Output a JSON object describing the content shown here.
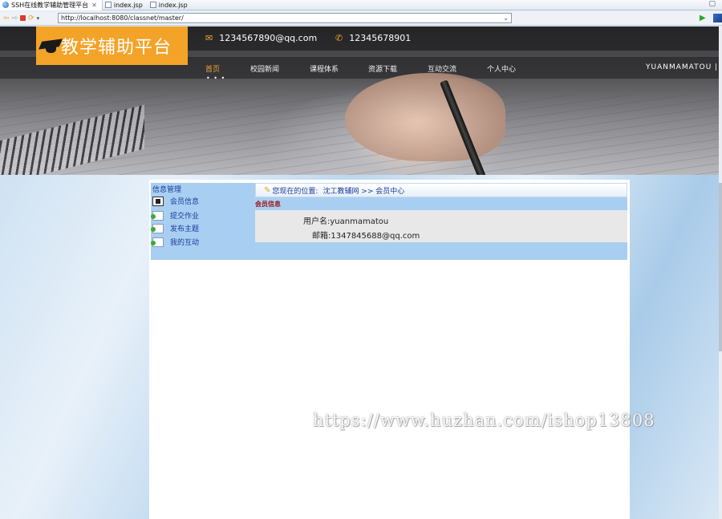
{
  "browser": {
    "tabs": [
      {
        "label": "SSH在线教学辅助管理平台",
        "active": true
      },
      {
        "label": "index.jsp",
        "active": false
      },
      {
        "label": "index.jsp",
        "active": false
      }
    ],
    "url": "http://localhost:8080/classnet/master/"
  },
  "header": {
    "logo_text": "教学辅助平台",
    "email": "1234567890@qq.com",
    "phone": "12345678901",
    "nav": [
      "首页",
      "校园新闻",
      "课程体系",
      "资源下载",
      "互动交流",
      "个人中心"
    ],
    "nav_dots": "• • •",
    "username": "YUANMAMATOU |",
    "accent_color": "#f4a329"
  },
  "sidebar": {
    "heading": "信息管理",
    "items": [
      "会员信息",
      "提交作业",
      "发布主题",
      "我的互动"
    ]
  },
  "breadcrumb": {
    "prefix": "您现在的位置:",
    "path": "沈工教辅网 >> 会员中心"
  },
  "member": {
    "section": "会员信息",
    "username": "用户名:yuanmamatou",
    "email": "邮箱:1347845688@qq.com"
  },
  "watermark": "https://www.huzhan.com/ishop13808"
}
